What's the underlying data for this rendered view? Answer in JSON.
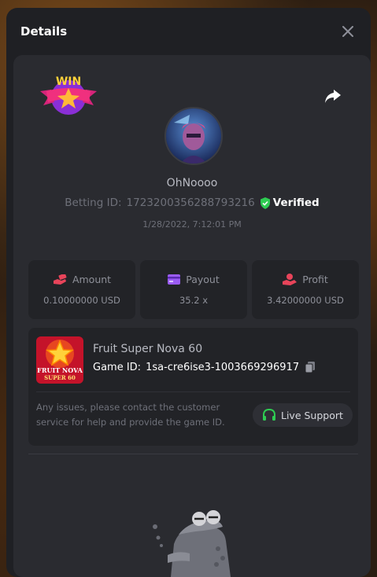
{
  "modal": {
    "title": "Details"
  },
  "bet": {
    "username": "OhNoooo",
    "betting_id_label": "Betting ID:",
    "betting_id": "1723200356288793216",
    "verified_label": "Verified",
    "timestamp": "1/28/2022, 7:12:01 PM",
    "badge_text": "WIN"
  },
  "stats": [
    {
      "label": "Amount",
      "value": "0.10000000 USD",
      "icon": "money-hand-icon",
      "color": "#e8445a"
    },
    {
      "label": "Payout",
      "value": "35.2 x",
      "icon": "card-icon",
      "color": "#9b5cf5"
    },
    {
      "label": "Profit",
      "value": "3.42000000 USD",
      "icon": "coin-hand-icon",
      "color": "#e8445a"
    }
  ],
  "game": {
    "name": "Fruit Super Nova 60",
    "id_label": "Game ID:",
    "id": "1sa-cre6ise3-1003669296917",
    "thumb_text_line1": "FRUIT NOVA",
    "thumb_text_line2": "SUPER 60",
    "help_text": "Any issues, please contact the customer service for help and provide the game ID.",
    "support_label": "Live Support"
  },
  "colors": {
    "verified": "#2ecc52",
    "support_icon": "#2ecc52",
    "panel": "#2a2b30",
    "card": "#222327"
  }
}
